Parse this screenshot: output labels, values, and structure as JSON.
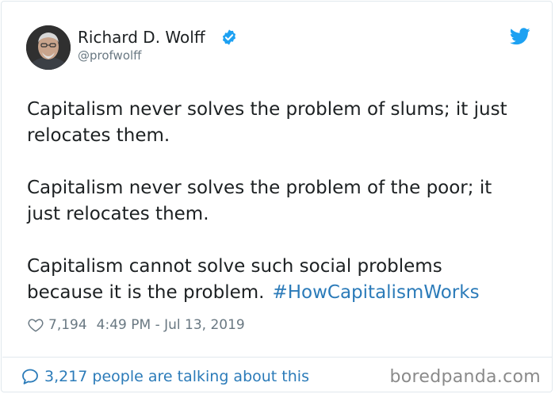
{
  "author": {
    "name": "Richard D. Wolff",
    "handle": "@profwolff",
    "verified_icon": "verified-badge-icon",
    "avatar": "profile-photo"
  },
  "platform_icon": "twitter-bird-icon",
  "tweet": {
    "paragraphs": [
      "Capitalism never solves the problem of slums; it just\nrelocates them.",
      "Capitalism never solves the problem of the poor; it\njust relocates them.",
      "Capitalism cannot solve such social problems\nbecause it is the problem."
    ],
    "hashtag": "#HowCapitalismWorks"
  },
  "meta": {
    "like_count": "7,194",
    "timestamp": "4:49 PM - Jul 13, 2019"
  },
  "footer": {
    "talking_text": "3,217 people are talking about this",
    "watermark": "boredpanda.com"
  },
  "colors": {
    "link_blue": "#2b7bb9",
    "verified_blue": "#1da1f2",
    "text": "#1c2022",
    "muted": "#697882"
  }
}
